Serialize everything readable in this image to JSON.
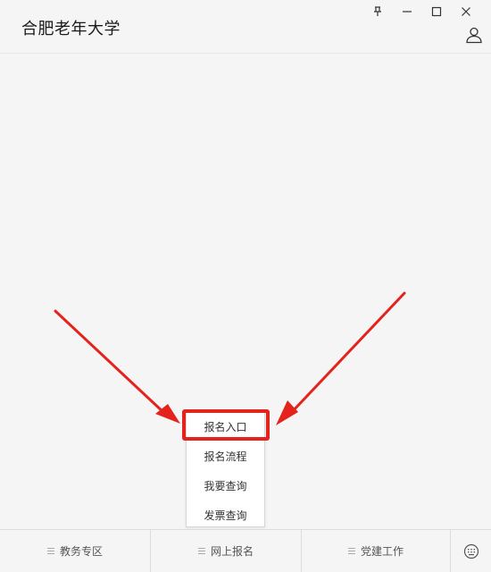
{
  "header": {
    "title": "合肥老年大学",
    "controls": [
      {
        "name": "pin-icon",
        "label": "pin"
      },
      {
        "name": "minimize-icon",
        "label": "minimize"
      },
      {
        "name": "maximize-icon",
        "label": "maximize"
      },
      {
        "name": "close-icon",
        "label": "close"
      }
    ],
    "user_icon": "user-icon"
  },
  "popup_menu": {
    "items": [
      {
        "label": "报名入口",
        "highlighted": true
      },
      {
        "label": "报名流程"
      },
      {
        "label": "我要查询"
      },
      {
        "label": "发票查询"
      }
    ]
  },
  "annotation": {
    "color": "#e3231c"
  },
  "tabbar": {
    "tabs": [
      {
        "label": "教务专区",
        "icon": "menu-icon"
      },
      {
        "label": "网上报名",
        "icon": "menu-icon"
      },
      {
        "label": "党建工作",
        "icon": "menu-icon"
      }
    ],
    "keyboard_icon": "keyboard-icon"
  },
  "colors": {
    "background": "#f5f5f5",
    "accent": "#e3231c",
    "text": "#1a1a1a"
  }
}
